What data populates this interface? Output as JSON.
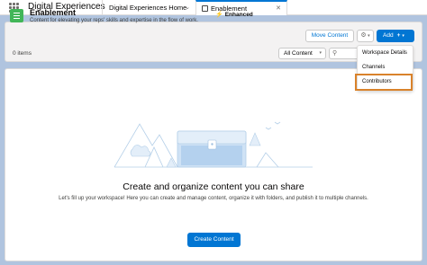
{
  "app": {
    "name": "Digital Experiences"
  },
  "tabs": [
    {
      "label": "Digital Experiences Home"
    },
    {
      "label": "Enablement"
    }
  ],
  "header": {
    "title": "Enablement",
    "description": "Content for elevating your reps' skills and expertise in the flow of work.",
    "badge": "Enhanced",
    "item_count": "0 items",
    "move_content_label": "Move Content",
    "add_label": "Add",
    "filter_value": "All Content"
  },
  "menu": {
    "items": [
      {
        "label": "Workspace Details"
      },
      {
        "label": "Channels"
      },
      {
        "label": "Contributors"
      }
    ],
    "highlight_color": "#d9822b"
  },
  "empty_state": {
    "title": "Create and organize content you can share",
    "description": "Let's fill up your workspace! Here you can create and manage content, organize it with folders, and publish it to multiple channels.",
    "create_label": "Create Content"
  },
  "colors": {
    "brand": "#0176d3",
    "workspace_icon": "#41b658",
    "page_bg": "#b0c4df"
  }
}
